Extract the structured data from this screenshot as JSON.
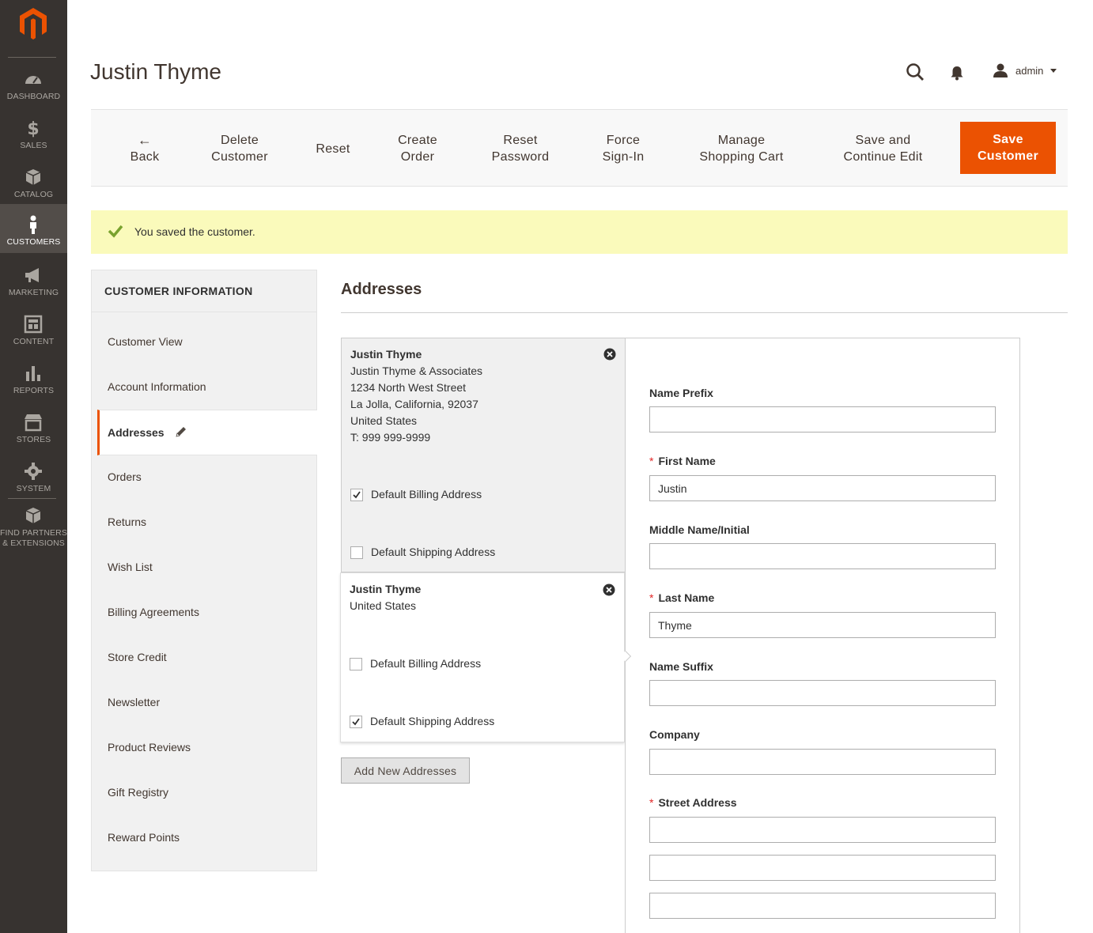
{
  "menu": {
    "items": [
      {
        "label": "DASHBOARD",
        "icon": "dashboard-icon"
      },
      {
        "label": "SALES",
        "icon": "dollar-icon"
      },
      {
        "label": "CATALOG",
        "icon": "box-icon"
      },
      {
        "label": "CUSTOMERS",
        "icon": "person-icon",
        "active": true
      },
      {
        "label": "MARKETING",
        "icon": "megaphone-icon"
      },
      {
        "label": "CONTENT",
        "icon": "layout-icon"
      },
      {
        "label": "REPORTS",
        "icon": "bar-chart-icon"
      },
      {
        "label": "STORES",
        "icon": "storefront-icon"
      },
      {
        "label": "SYSTEM",
        "icon": "gear-icon"
      },
      {
        "label": "FIND PARTNERS",
        "label2": "& EXTENSIONS",
        "icon": "cube-icon"
      }
    ]
  },
  "header": {
    "title": "Justin Thyme",
    "user": "admin"
  },
  "toolbar": {
    "back": "Back",
    "delete_1": "Delete",
    "delete_2": "Customer",
    "reset": "Reset",
    "create_1": "Create",
    "create_2": "Order",
    "resetpw_1": "Reset",
    "resetpw_2": "Password",
    "force_1": "Force",
    "force_2": "Sign-In",
    "cart_1": "Manage",
    "cart_2": "Shopping Cart",
    "savecont_1": "Save and",
    "savecont_2": "Continue Edit",
    "save_1": "Save",
    "save_2": "Customer"
  },
  "message": "You saved the customer.",
  "tabs": {
    "title": "CUSTOMER INFORMATION",
    "items": [
      "Customer View",
      "Account Information",
      "Addresses",
      "Orders",
      "Returns",
      "Wish List",
      "Billing Agreements",
      "Store Credit",
      "Newsletter",
      "Product Reviews",
      "Gift Registry",
      "Reward Points"
    ],
    "active": "Addresses"
  },
  "addresses": {
    "title": "Addresses",
    "cards": [
      {
        "name": "Justin Thyme",
        "lines": [
          "Justin Thyme & Associates",
          "1234 North West Street",
          "La Jolla, California, 92037",
          "United States",
          "T: 999 999-9999"
        ],
        "default_billing_label": "Default Billing Address",
        "default_billing": true,
        "default_shipping_label": "Default Shipping Address",
        "default_shipping": false
      },
      {
        "name": "Justin Thyme",
        "lines": [
          "United States"
        ],
        "default_billing_label": "Default Billing Address",
        "default_billing": false,
        "default_shipping_label": "Default Shipping Address",
        "default_shipping": true
      }
    ],
    "add_button": "Add New Addresses"
  },
  "form": {
    "name_prefix": {
      "label": "Name Prefix",
      "value": ""
    },
    "first_name": {
      "label": "First Name",
      "value": "Justin",
      "required": true
    },
    "middle_name": {
      "label": "Middle Name/Initial",
      "value": ""
    },
    "last_name": {
      "label": "Last Name",
      "value": "Thyme",
      "required": true
    },
    "name_suffix": {
      "label": "Name Suffix",
      "value": ""
    },
    "company": {
      "label": "Company",
      "value": ""
    },
    "street": {
      "label": "Street Address",
      "required": true,
      "lines": [
        "",
        "",
        ""
      ]
    },
    "required_marker": "*"
  },
  "colors": {
    "menu_bg": "#373330",
    "accent": "#eb5202",
    "message_bg": "#fafabb",
    "success": "#79a22e"
  }
}
